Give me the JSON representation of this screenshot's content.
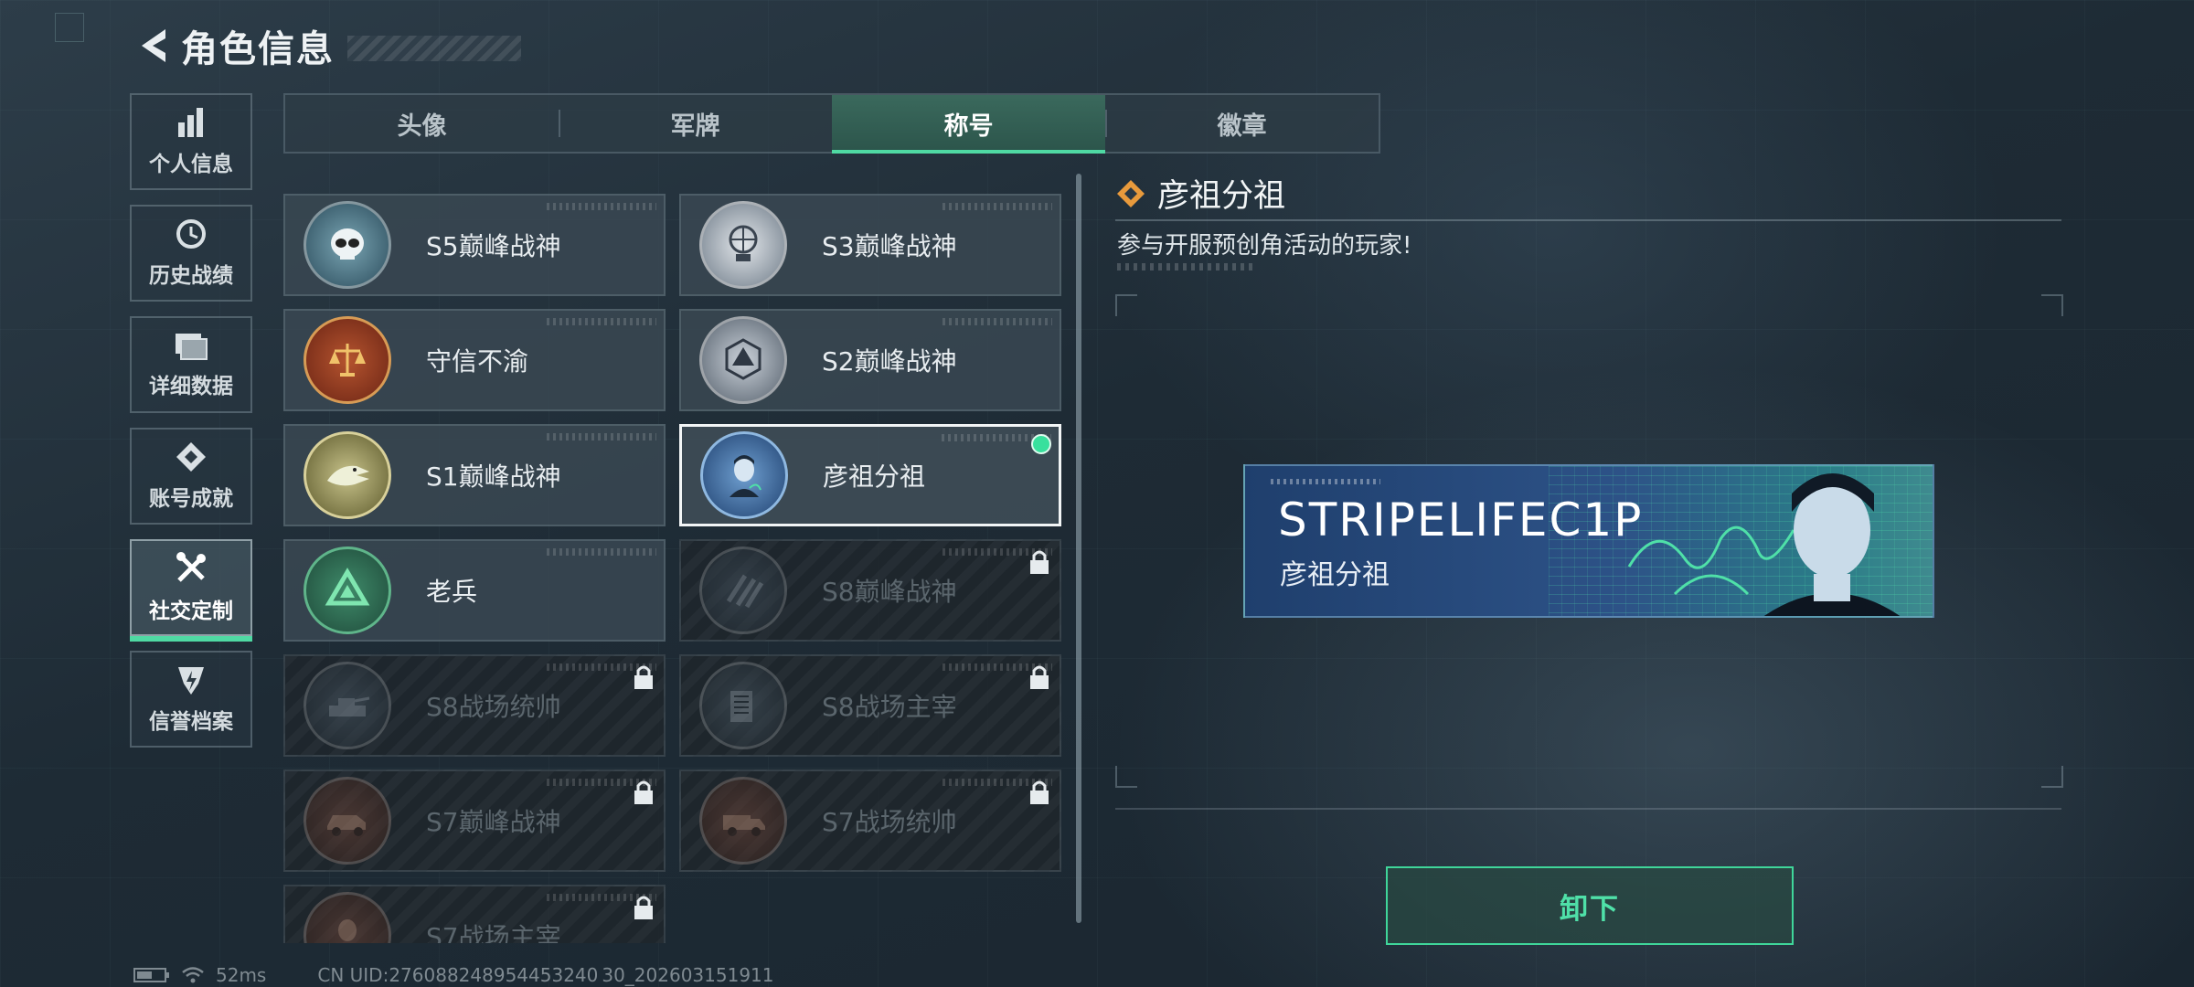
{
  "header": {
    "title": "角色信息"
  },
  "side_nav": {
    "items": [
      {
        "label": "个人信息",
        "icon": "bar-chart-icon"
      },
      {
        "label": "历史战绩",
        "icon": "history-clock-icon"
      },
      {
        "label": "详细数据",
        "icon": "folder-icon"
      },
      {
        "label": "账号成就",
        "icon": "diamond-achievement-icon"
      },
      {
        "label": "社交定制",
        "icon": "tools-icon",
        "active": true
      },
      {
        "label": "信誉档案",
        "icon": "credit-shield-icon"
      }
    ]
  },
  "tabs": [
    {
      "label": "头像"
    },
    {
      "label": "军牌"
    },
    {
      "label": "称号",
      "active": true
    },
    {
      "label": "徽章"
    }
  ],
  "titles": [
    {
      "label": "S5巅峰战神",
      "locked": false
    },
    {
      "label": "S3巅峰战神",
      "locked": false
    },
    {
      "label": "守信不渝",
      "locked": false
    },
    {
      "label": "S2巅峰战神",
      "locked": false
    },
    {
      "label": "S1巅峰战神",
      "locked": false
    },
    {
      "label": "彦祖分祖",
      "locked": false,
      "selected": true,
      "equipped": true
    },
    {
      "label": "老兵",
      "locked": false
    },
    {
      "label": "S8巅峰战神",
      "locked": true
    },
    {
      "label": "S8战场统帅",
      "locked": true
    },
    {
      "label": "S8战场主宰",
      "locked": true
    },
    {
      "label": "S7巅峰战神",
      "locked": true
    },
    {
      "label": "S7战场统帅",
      "locked": true
    },
    {
      "label": "S7战场主宰",
      "locked": true
    }
  ],
  "detail": {
    "title": "彦祖分祖",
    "description": "参与开服预创角活动的玩家!",
    "banner_name": "STRIPELIFEC1P",
    "banner_title": "彦祖分祖",
    "action_label": "卸下"
  },
  "status": {
    "ping": "52ms",
    "uid": "CN UID:276088248954453240 30_202603151911"
  },
  "colors": {
    "accent": "#4fd9a3",
    "equipped": "#38e09d",
    "background": "#1e2b35"
  }
}
